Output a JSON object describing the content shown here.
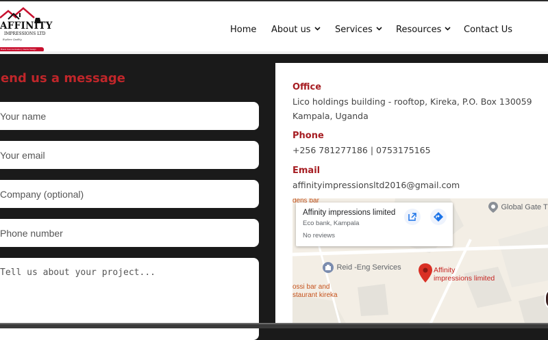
{
  "logo": {
    "name": "AFFINITY",
    "sub": "IMPRESSIONS LTD",
    "tagline": "Explore Quality",
    "ribbon": "Brand Communication | Interior Design"
  },
  "nav": {
    "home": "Home",
    "about": "About us",
    "services": "Services",
    "resources": "Resources",
    "contact": "Contact Us"
  },
  "form": {
    "title": "Send us a message",
    "name_placeholder": "Your name",
    "email_placeholder": "Your email",
    "company_placeholder": "Company (optional)",
    "phone_placeholder": "Phone number",
    "message_placeholder": "Tell us about your project..."
  },
  "contact": {
    "office_label": "Office",
    "office_value": "Lico holdings building - rooftop, Kireka, P.O. Box 130059 Kampala, Uganda",
    "phone_label": "Phone",
    "phone_value": "+256 781277186 | 0753175165",
    "email_label": "Email",
    "email_value": "affinityimpressionsltd2016@gmail.com"
  },
  "map": {
    "card_title": "Affinity impressions limited",
    "card_address": "Eco bank, Kampala",
    "card_reviews": "No reviews",
    "place_global_gate": "Global Gate Tr",
    "place_reid": "Reid -Eng Services",
    "place_affinity_line1": "Affinity",
    "place_affinity_line2": "impressions limited",
    "place_bar_line1": "ossi bar and",
    "place_bar_line2": "staurant kireka",
    "place_top_left": "dens bar",
    "open_icon": "open-in-new-icon",
    "directions_icon": "directions-icon",
    "colors": {
      "marker": "#d93025",
      "link": "#1a73e8",
      "poi_label": "#c5521c",
      "poi_gray": "#5f6368"
    }
  },
  "colors": {
    "brand_red": "#c0262a",
    "label_red": "#a61d22",
    "dark_bg": "#1a1a1a"
  }
}
